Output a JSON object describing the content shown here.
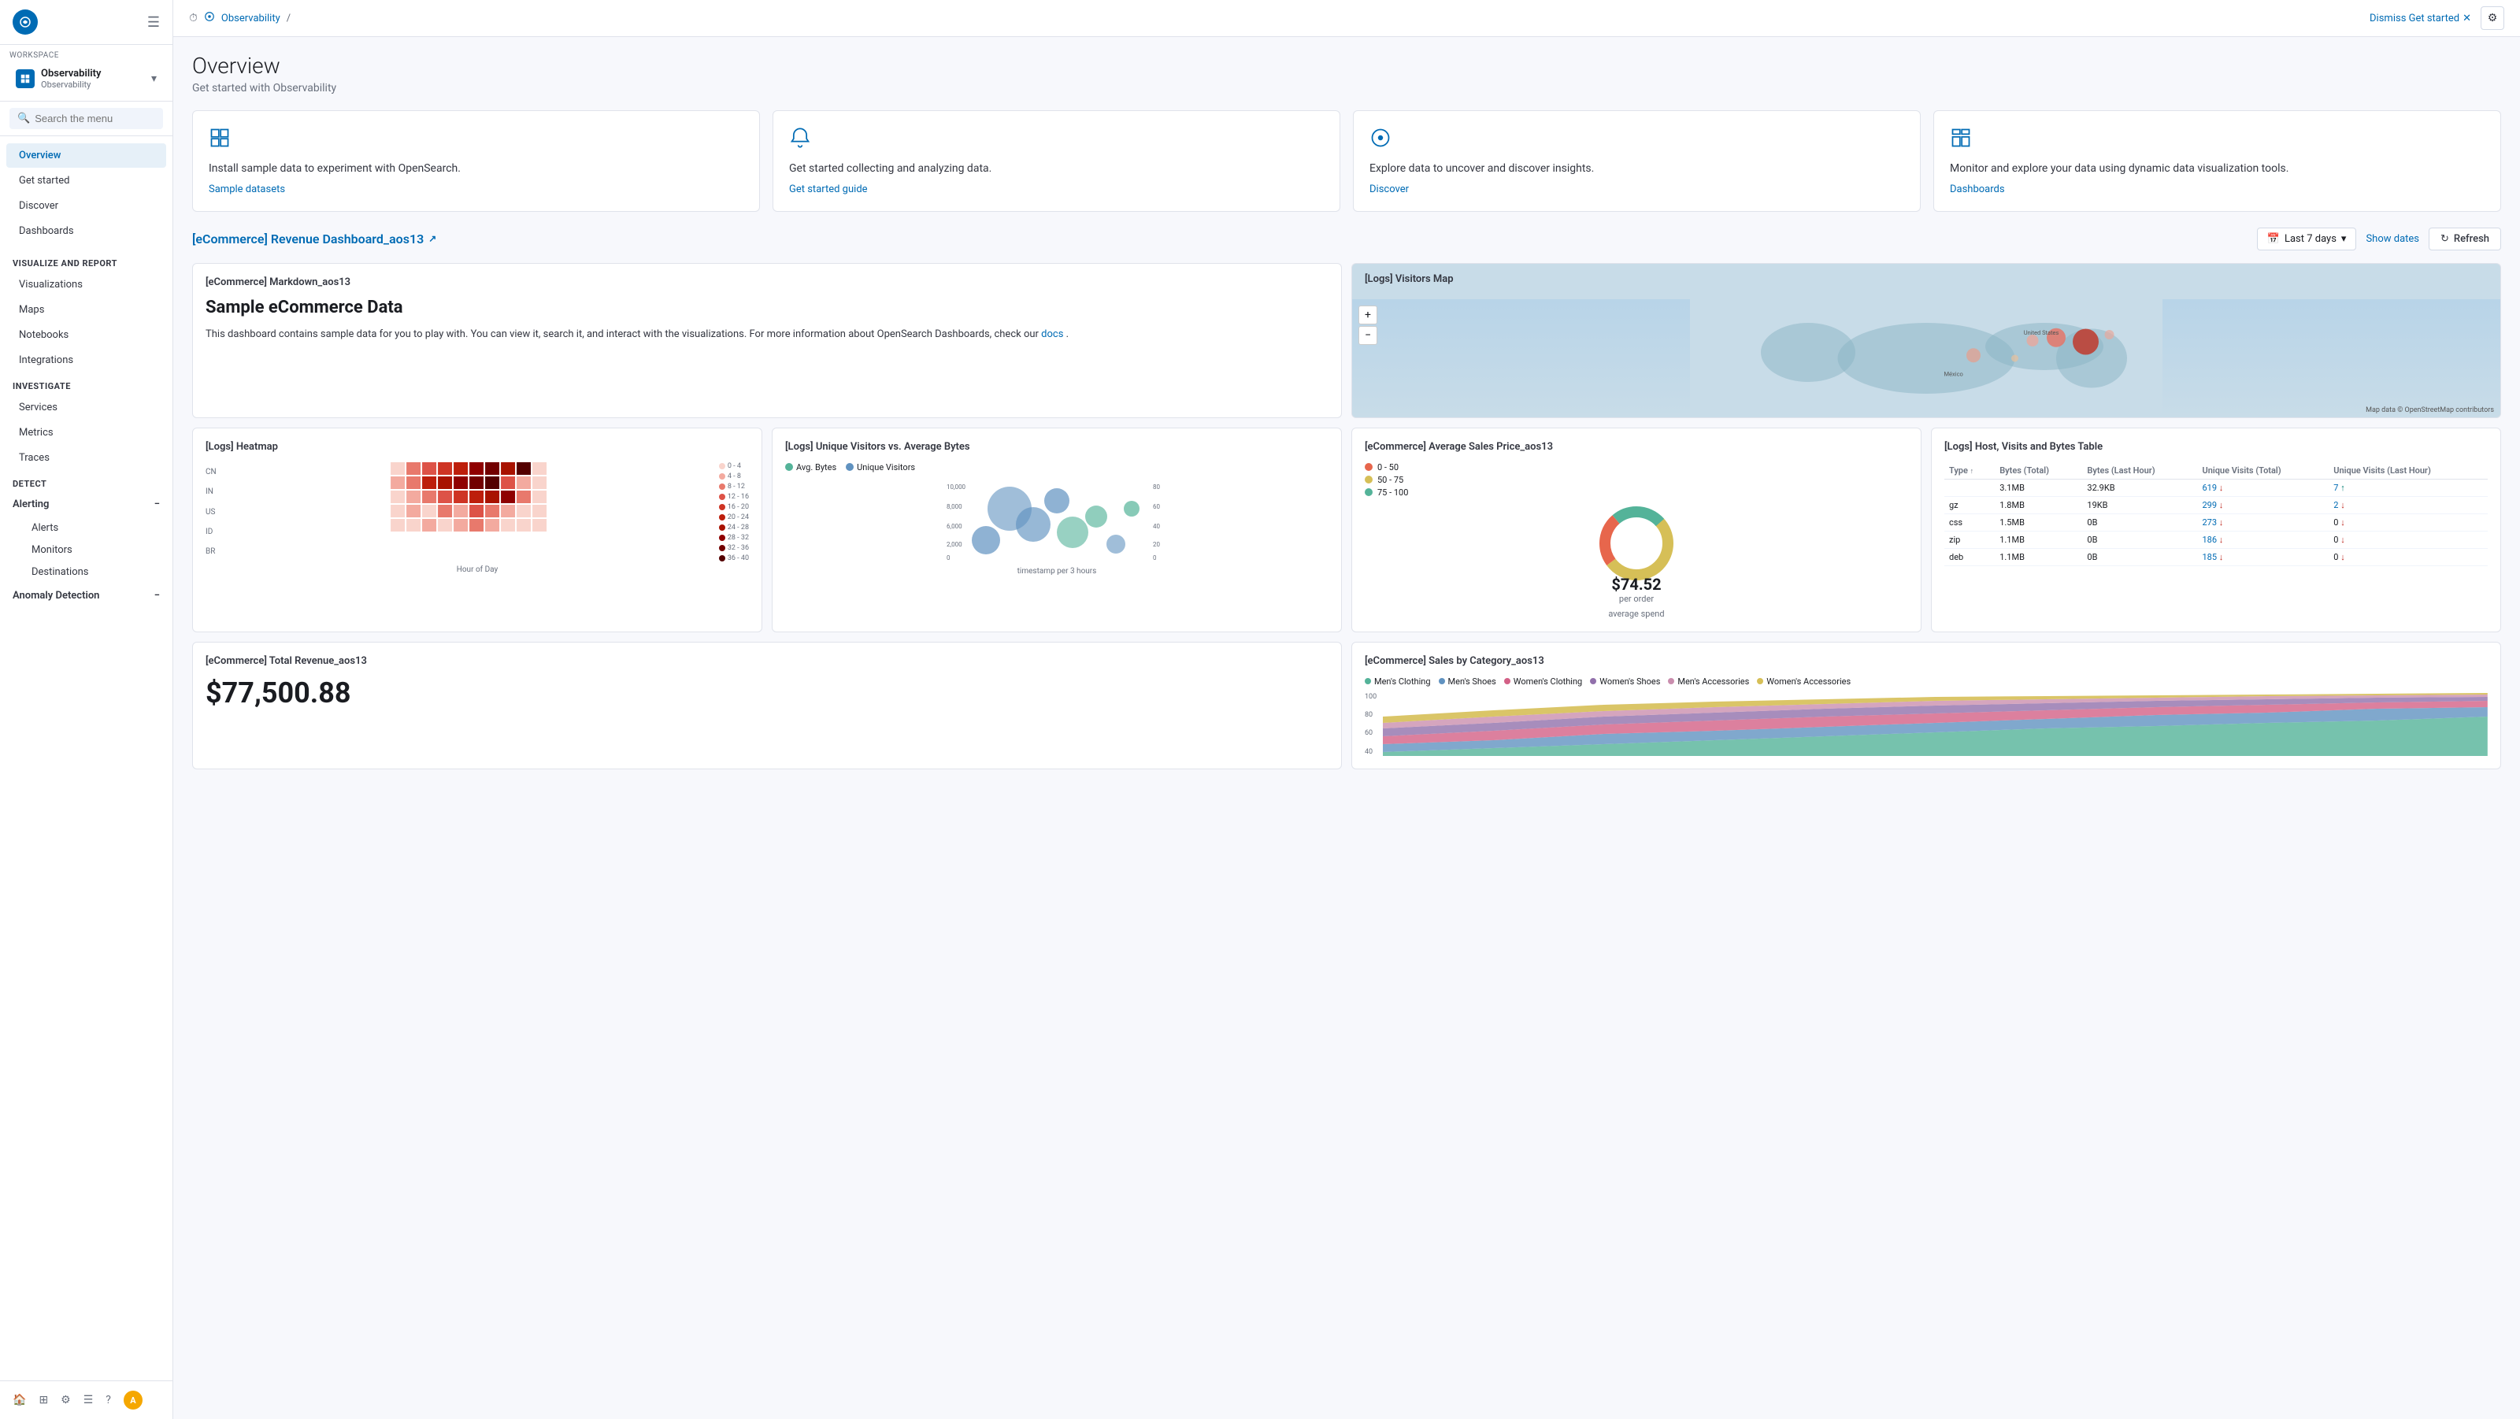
{
  "sidebar": {
    "logo_text": "O",
    "workspace_label": "WORKSPACE",
    "workspace_name": "Observability",
    "workspace_sub": "Observability",
    "search_placeholder": "Search the menu",
    "nav": [
      {
        "id": "overview",
        "label": "Overview",
        "active": true
      },
      {
        "id": "get-started",
        "label": "Get started"
      },
      {
        "id": "discover",
        "label": "Discover"
      },
      {
        "id": "dashboards",
        "label": "Dashboards"
      }
    ],
    "section_visualize": "Visualize and report",
    "nav_visualize": [
      {
        "id": "visualizations",
        "label": "Visualizations"
      },
      {
        "id": "maps",
        "label": "Maps"
      },
      {
        "id": "notebooks",
        "label": "Notebooks"
      },
      {
        "id": "integrations",
        "label": "Integrations"
      }
    ],
    "section_investigate": "Investigate",
    "nav_investigate": [
      {
        "id": "services",
        "label": "Services"
      },
      {
        "id": "metrics",
        "label": "Metrics"
      },
      {
        "id": "traces",
        "label": "Traces"
      }
    ],
    "section_detect": "Detect",
    "alerting_label": "Alerting",
    "nav_alerting_sub": [
      {
        "id": "alerts",
        "label": "Alerts"
      },
      {
        "id": "monitors",
        "label": "Monitors"
      },
      {
        "id": "destinations",
        "label": "Destinations"
      }
    ],
    "anomaly_label": "Anomaly Detection"
  },
  "topbar": {
    "breadcrumb_icon": "⏱",
    "breadcrumb_text": "Observability",
    "dismiss_label": "Dismiss Get started",
    "settings_icon": "⚙"
  },
  "page": {
    "title": "Overview",
    "subtitle": "Get started with Observability"
  },
  "cards": [
    {
      "icon": "grid",
      "title": "Install sample data to experiment with OpenSearch.",
      "link": "Sample datasets"
    },
    {
      "icon": "bell",
      "title": "Get started collecting and analyzing data.",
      "link": "Get started guide"
    },
    {
      "icon": "search",
      "title": "Explore data to uncover and discover insights.",
      "link": "Discover"
    },
    {
      "icon": "grid2",
      "title": "Monitor and explore your data using dynamic data visualization tools.",
      "link": "Dashboards"
    }
  ],
  "dashboard": {
    "title": "[eCommerce] Revenue Dashboard_aos13",
    "date_range": "Last 7 days",
    "show_dates": "Show dates",
    "refresh": "Refresh",
    "widgets": {
      "markdown": {
        "title": "[eCommerce] Markdown_aos13",
        "heading": "Sample eCommerce Data",
        "body": "This dashboard contains sample data for you to play with. You can view it, search it, and interact with the visualizations. For more information about OpenSearch Dashboards, check our",
        "link_text": "docs",
        "body_end": "."
      },
      "visitors_map": {
        "title": "[Logs] Visitors Map"
      },
      "heatmap": {
        "title": "[Logs] Heatmap",
        "x_label": "Hour of Day",
        "y_labels": [
          "CN",
          "IN",
          "US",
          "ID",
          "BR"
        ],
        "legend": [
          {
            "label": "0 - 4",
            "color": "#f9d4cc"
          },
          {
            "label": "4 - 8",
            "color": "#f3aa9f"
          },
          {
            "label": "8 - 12",
            "color": "#e8796c"
          },
          {
            "label": "12 - 16",
            "color": "#dd5247"
          },
          {
            "label": "16 - 20",
            "color": "#ce3424"
          },
          {
            "label": "20 - 24",
            "color": "#bd1e0b"
          },
          {
            "label": "24 - 28",
            "color": "#a81200"
          },
          {
            "label": "28 - 32",
            "color": "#8f0000"
          },
          {
            "label": "32 - 36",
            "color": "#720000"
          },
          {
            "label": "36 - 40",
            "color": "#540000"
          }
        ]
      },
      "visitors_chart": {
        "title": "[Logs] Unique Visitors vs. Average Bytes",
        "x_label": "timestamp per 3 hours",
        "legend": [
          {
            "label": "Avg. Bytes",
            "color": "#54b399"
          },
          {
            "label": "Unique Visitors",
            "color": "#6092c0"
          }
        ]
      },
      "avg_sales": {
        "title": "[eCommerce] Average Sales Price_aos13",
        "value": "$74.52",
        "sub": "per order",
        "label": "average spend",
        "legend": [
          {
            "label": "0 - 50",
            "color": "#e7664c"
          },
          {
            "label": "50 - 75",
            "color": "#d6bf57"
          },
          {
            "label": "75 - 100",
            "color": "#54b399"
          }
        ]
      },
      "host_table": {
        "title": "[Logs] Host, Visits and Bytes Table",
        "columns": [
          "Type",
          "Bytes (Total)",
          "Bytes (Last Hour)",
          "Unique Visits (Total)",
          "Unique Visits (Last Hour)"
        ],
        "rows": [
          {
            "type": "",
            "bytes_total": "3.1MB",
            "bytes_last": "32.9KB",
            "visits_total": "619",
            "visits_last": "7",
            "visits_total_dir": "down",
            "visits_last_dir": "up"
          },
          {
            "type": "gz",
            "bytes_total": "1.8MB",
            "bytes_last": "19KB",
            "visits_total": "299",
            "visits_last": "2",
            "visits_total_dir": "down",
            "visits_last_dir": "down"
          },
          {
            "type": "css",
            "bytes_total": "1.5MB",
            "bytes_last": "0B",
            "visits_total": "273",
            "visits_last": "0",
            "visits_total_dir": "down",
            "visits_last_dir": "down"
          },
          {
            "type": "zip",
            "bytes_total": "1.1MB",
            "bytes_last": "0B",
            "visits_total": "186",
            "visits_last": "0",
            "visits_total_dir": "down",
            "visits_last_dir": "down"
          },
          {
            "type": "deb",
            "bytes_total": "1.1MB",
            "bytes_last": "0B",
            "visits_total": "185",
            "visits_last": "0",
            "visits_total_dir": "down",
            "visits_last_dir": "down"
          }
        ]
      },
      "total_revenue": {
        "title": "[eCommerce] Total Revenue_aos13",
        "value": "$77,500.88"
      },
      "sales_category": {
        "title": "[eCommerce] Sales by Category_aos13",
        "legend": [
          {
            "label": "Men's Clothing",
            "color": "#54b399"
          },
          {
            "label": "Men's Shoes",
            "color": "#6092c0"
          },
          {
            "label": "Women's Clothing",
            "color": "#d36086"
          },
          {
            "label": "Women's Shoes",
            "color": "#9170ab"
          },
          {
            "label": "Men's Accessories",
            "color": "#ca8eae"
          },
          {
            "label": "Women's Accessories",
            "color": "#d6bf57"
          }
        ],
        "y_labels": [
          "100",
          "80",
          "60",
          "40"
        ]
      }
    }
  }
}
